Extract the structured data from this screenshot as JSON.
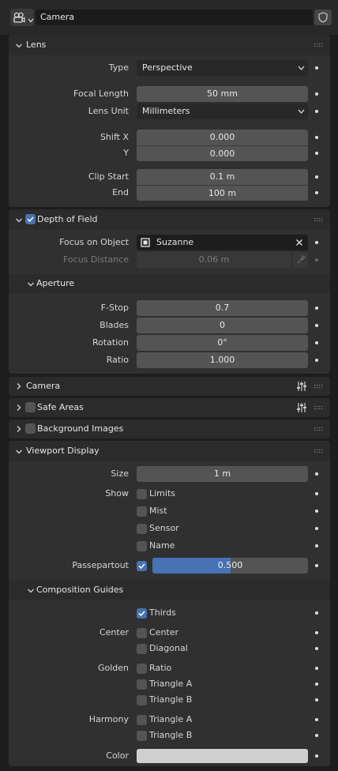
{
  "header": {
    "icon": "camera-data-icon",
    "name": "Camera",
    "shield_icon": "fake-user-shield-icon"
  },
  "lens": {
    "title": "Lens",
    "type": {
      "label": "Type",
      "value": "Perspective"
    },
    "focal_length": {
      "label": "Focal Length",
      "value": "50 mm"
    },
    "lens_unit": {
      "label": "Lens Unit",
      "value": "Millimeters"
    },
    "shift_x": {
      "label": "Shift X",
      "value": "0.000"
    },
    "shift_y": {
      "label": "Y",
      "value": "0.000"
    },
    "clip_start": {
      "label": "Clip Start",
      "value": "0.1 m"
    },
    "clip_end": {
      "label": "End",
      "value": "100 m"
    }
  },
  "dof": {
    "title": "Depth of Field",
    "enabled": true,
    "focus_object": {
      "label": "Focus on Object",
      "value": "Suzanne"
    },
    "focus_distance": {
      "label": "Focus Distance",
      "value": "0.06 m"
    },
    "aperture": {
      "title": "Aperture",
      "fstop": {
        "label": "F-Stop",
        "value": "0.7"
      },
      "blades": {
        "label": "Blades",
        "value": "0"
      },
      "rotation": {
        "label": "Rotation",
        "value": "0°"
      },
      "ratio": {
        "label": "Ratio",
        "value": "1.000"
      }
    }
  },
  "camera_panel": {
    "title": "Camera"
  },
  "safe_areas": {
    "title": "Safe Areas",
    "enabled": false
  },
  "background_images": {
    "title": "Background Images",
    "enabled": false
  },
  "viewport_display": {
    "title": "Viewport Display",
    "size": {
      "label": "Size",
      "value": "1 m"
    },
    "show": {
      "label": "Show",
      "items": [
        "Limits",
        "Mist",
        "Sensor",
        "Name"
      ]
    },
    "passepartout": {
      "label": "Passepartout",
      "enabled": true,
      "value": "0.500",
      "fraction": 0.5
    },
    "composition_guides": {
      "title": "Composition Guides",
      "thirds": "Thirds",
      "center_label": "Center",
      "center": [
        "Center",
        "Diagonal"
      ],
      "golden_label": "Golden",
      "golden": [
        "Ratio",
        "Triangle A",
        "Triangle B"
      ],
      "harmony_label": "Harmony",
      "harmony": [
        "Triangle A",
        "Triangle B"
      ],
      "color": {
        "label": "Color",
        "value": "#d0d0d0"
      }
    }
  }
}
